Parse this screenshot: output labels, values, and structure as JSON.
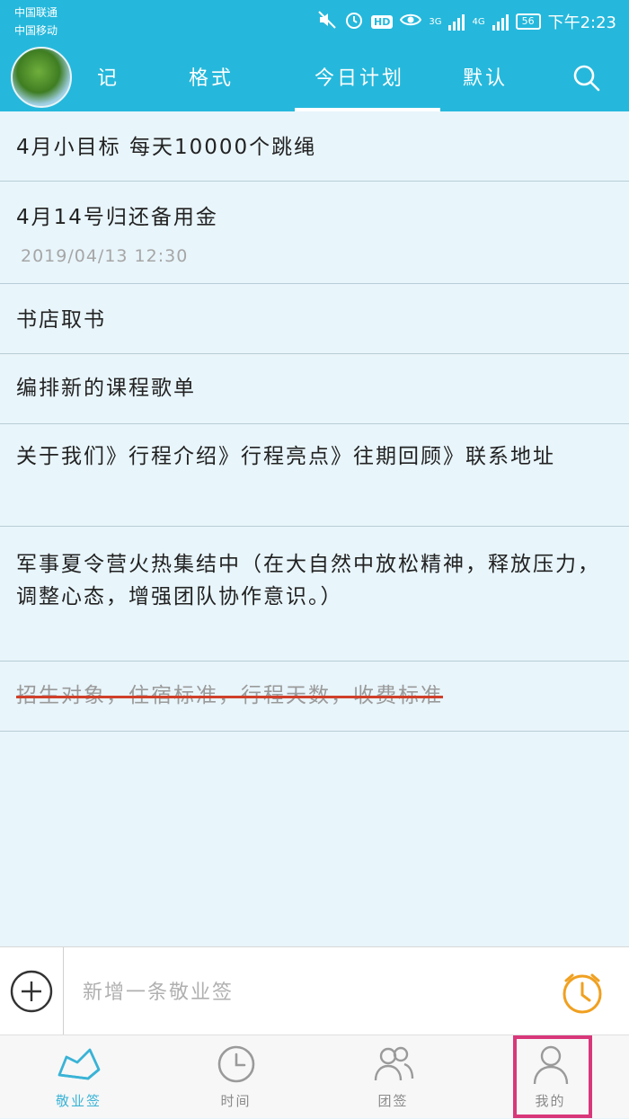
{
  "status_bar": {
    "carrier1": "中国联通",
    "carrier2": "中国移动",
    "hd": "HD",
    "net1": "3G",
    "net2": "4G",
    "battery": "56",
    "time": "下午2:23"
  },
  "top_tabs": [
    {
      "label": "记"
    },
    {
      "label": "格式"
    },
    {
      "label": "今日计划",
      "active": true
    },
    {
      "label": "默认"
    }
  ],
  "notes": [
    {
      "text": "4月小目标 每天10000个跳绳"
    },
    {
      "text": "4月14号归还备用金",
      "date": "2019/04/13 12:30"
    },
    {
      "text": "书店取书"
    },
    {
      "text": "编排新的课程歌单"
    },
    {
      "text": "关于我们》行程介绍》行程亮点》往期回顾》联系地址"
    },
    {
      "text": "军事夏令营火热集结中（在大自然中放松精神，释放压力，调整心态，增强团队协作意识。）"
    },
    {
      "text": "招生对象，住宿标准，行程天数，收费标准",
      "completed": true
    }
  ],
  "input": {
    "placeholder": "新增一条敬业签"
  },
  "bottom_nav": [
    {
      "label": "敬业签",
      "active": true
    },
    {
      "label": "时间"
    },
    {
      "label": "团签"
    },
    {
      "label": "我的"
    }
  ],
  "colors": {
    "header": "#25b8dc",
    "background": "#e8f5fb",
    "accent_orange": "#f0a020",
    "active_nav": "#3ab3d6",
    "highlight": "#d8377a",
    "strike": "#d0402a"
  }
}
